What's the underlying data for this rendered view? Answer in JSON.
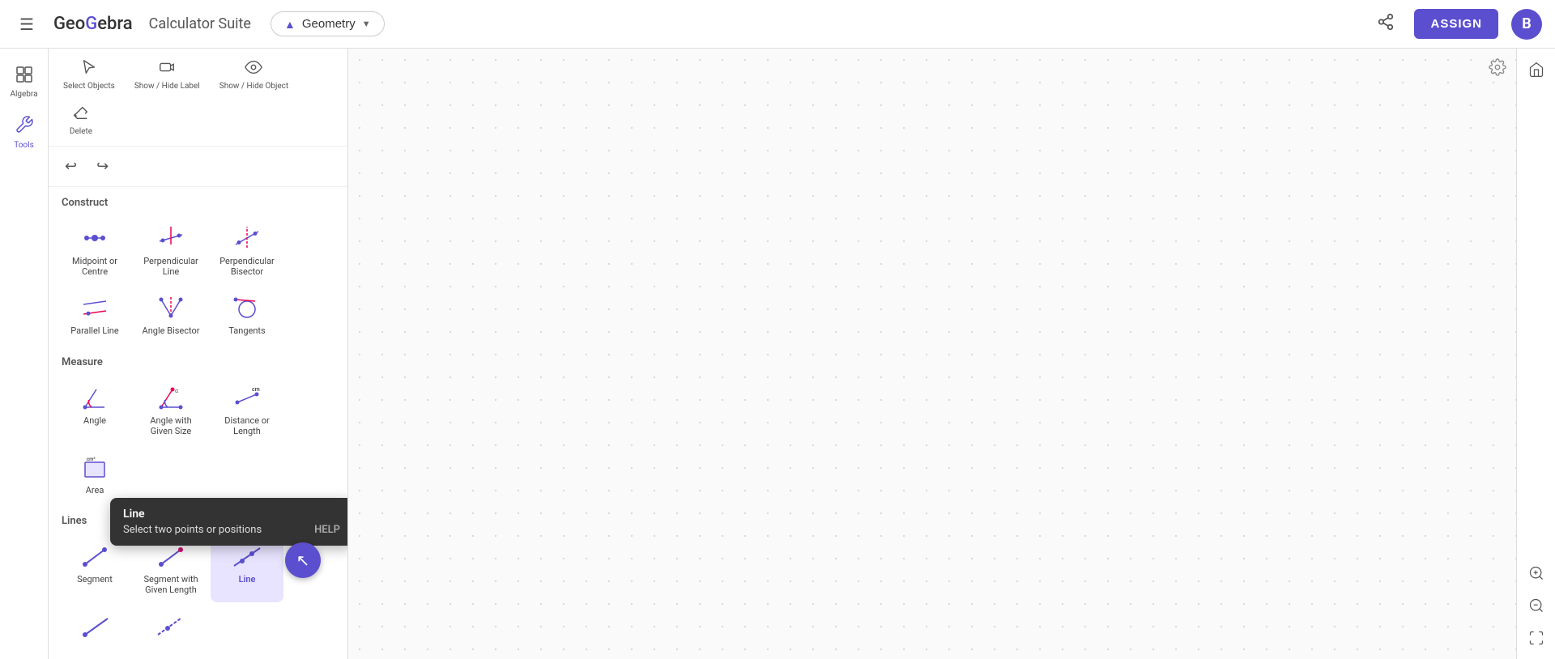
{
  "header": {
    "menu_icon": "☰",
    "logo": "GeoGebra",
    "logo_highlight_chars": [
      3,
      7
    ],
    "app_name": "Calculator Suite",
    "geometry_btn": "Geometry",
    "geometry_icon": "▲",
    "share_icon": "⤢",
    "assign_label": "ASSIGN",
    "avatar_letter": "B"
  },
  "sidebar": {
    "items": [
      {
        "id": "algebra",
        "icon": "⊞",
        "label": "Algebra",
        "active": false
      },
      {
        "id": "tools",
        "icon": "⚙",
        "label": "Tools",
        "active": true
      }
    ]
  },
  "tools_top_bar": [
    {
      "id": "select-objects",
      "icon": "↖",
      "label": "Select Objects"
    },
    {
      "id": "show-hide-label",
      "icon": "🏷",
      "label": "Show / Hide Label"
    },
    {
      "id": "show-hide-object",
      "icon": "👁",
      "label": "Show / Hide Object"
    },
    {
      "id": "delete",
      "icon": "✏",
      "label": "Delete"
    }
  ],
  "undo_icon": "↩",
  "redo_icon": "↪",
  "sections": [
    {
      "id": "construct",
      "label": "Construct",
      "tools": [
        {
          "id": "midpoint-centre",
          "label": "Midpoint or Centre",
          "icon_type": "midpoint"
        },
        {
          "id": "perpendicular-line",
          "label": "Perpendicular Line",
          "icon_type": "perp-line"
        },
        {
          "id": "perpendicular-bisector",
          "label": "Perpendicular Bisector",
          "icon_type": "perp-bisector"
        },
        {
          "id": "parallel-line",
          "label": "Parallel Line",
          "icon_type": "parallel"
        },
        {
          "id": "angle-bisector",
          "label": "Angle Bisector",
          "icon_type": "angle-bisector"
        },
        {
          "id": "tangents",
          "label": "Tangents",
          "icon_type": "tangents"
        }
      ]
    },
    {
      "id": "measure",
      "label": "Measure",
      "tools": [
        {
          "id": "angle",
          "label": "Angle",
          "icon_type": "angle"
        },
        {
          "id": "angle-given-size",
          "label": "Angle with Given Size",
          "icon_type": "angle-size"
        },
        {
          "id": "distance-length",
          "label": "Distance or Length",
          "icon_type": "distance"
        },
        {
          "id": "area",
          "label": "Area",
          "icon_type": "area"
        }
      ]
    },
    {
      "id": "lines",
      "label": "Lines",
      "tools": [
        {
          "id": "segment",
          "label": "Segment",
          "icon_type": "segment"
        },
        {
          "id": "segment-given-length",
          "label": "Segment with Given Length",
          "icon_type": "segment-len"
        },
        {
          "id": "line",
          "label": "Line",
          "icon_type": "line",
          "active": true
        },
        {
          "id": "ray1",
          "label": "",
          "icon_type": "ray"
        },
        {
          "id": "ray2",
          "label": "",
          "icon_type": "ray2"
        }
      ]
    }
  ],
  "tooltip": {
    "title": "Line",
    "description": "Select two points or positions",
    "help_label": "HELP"
  },
  "right_edge": {
    "home_icon": "⌂",
    "zoom_in_icon": "⊕",
    "zoom_out_icon": "⊖",
    "fullscreen_icon": "⛶",
    "settings_icon": "⚙"
  },
  "colors": {
    "accent": "#5b4fcf",
    "text_dark": "#333",
    "text_mid": "#555",
    "border": "#ddd",
    "tooltip_bg": "#333",
    "canvas_bg": "#fafafa"
  }
}
